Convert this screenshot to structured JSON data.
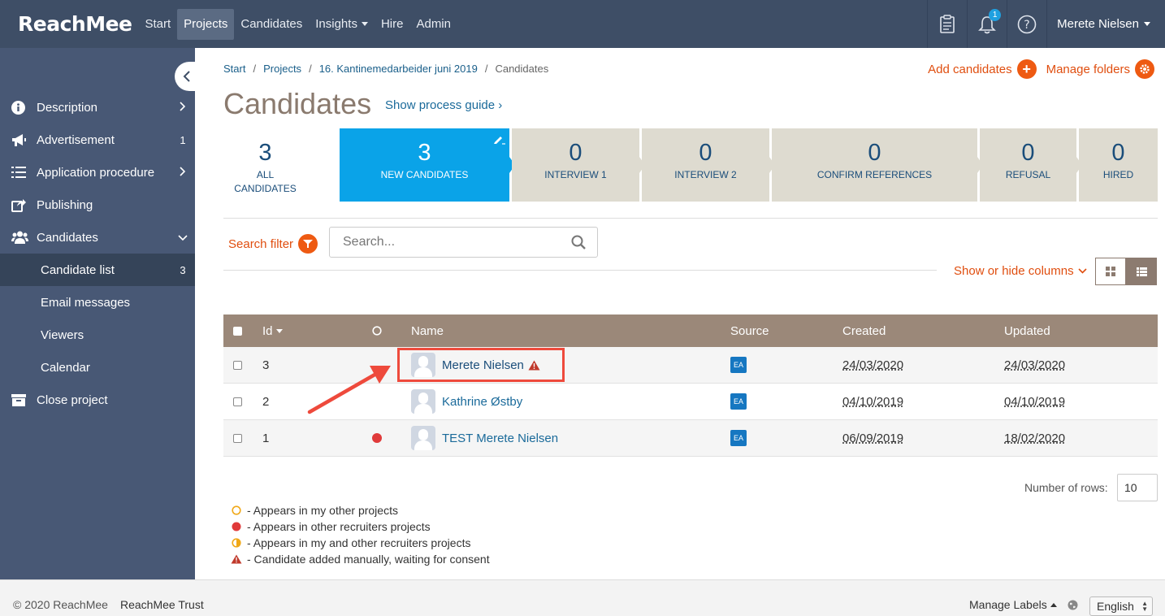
{
  "topnav": {
    "logo": "ReachMee",
    "items": [
      {
        "label": "Start"
      },
      {
        "label": "Projects"
      },
      {
        "label": "Candidates"
      },
      {
        "label": "Insights"
      },
      {
        "label": "Hire"
      },
      {
        "label": "Admin"
      }
    ],
    "notification_count": "1",
    "user": "Merete Nielsen"
  },
  "sidebar": {
    "items": [
      {
        "label": "Description",
        "icon": "info-icon"
      },
      {
        "label": "Advertisement",
        "icon": "megaphone-icon",
        "count": "1"
      },
      {
        "label": "Application procedure",
        "icon": "list-icon"
      },
      {
        "label": "Publishing",
        "icon": "share-icon"
      },
      {
        "label": "Candidates",
        "icon": "users-icon"
      },
      {
        "label": "Candidate list",
        "count": "3"
      },
      {
        "label": "Email messages"
      },
      {
        "label": "Viewers"
      },
      {
        "label": "Calendar"
      },
      {
        "label": "Close project",
        "icon": "archive-icon"
      }
    ]
  },
  "breadcrumb": {
    "start": "Start",
    "projects": "Projects",
    "project": "16. Kantinemedarbeider juni 2019",
    "current": "Candidates",
    "separator": "/"
  },
  "actions": {
    "add": "Add candidates",
    "manage": "Manage folders"
  },
  "page": {
    "title": "Candidates",
    "guide": "Show process guide ›"
  },
  "pipeline": [
    {
      "count": "3",
      "label": "All candidates"
    },
    {
      "count": "3",
      "label": "New candidates"
    },
    {
      "count": "0",
      "label": "Interview 1"
    },
    {
      "count": "0",
      "label": "Interview 2"
    },
    {
      "count": "0",
      "label": "Confirm references"
    },
    {
      "count": "0",
      "label": "Refusal"
    },
    {
      "count": "0",
      "label": "Hired"
    }
  ],
  "filter": {
    "label": "Search filter",
    "placeholder": "Search...",
    "columns_toggle": "Show or hide columns"
  },
  "table": {
    "headers": {
      "id": "Id",
      "name": "Name",
      "source": "Source",
      "created": "Created",
      "updated": "Updated"
    },
    "rows": [
      {
        "id": "3",
        "name": "Merete Nielsen",
        "source": "EA",
        "created": "24/03/2020",
        "updated": "24/03/2020"
      },
      {
        "id": "2",
        "name": "Kathrine Østby",
        "source": "EA",
        "created": "04/10/2019",
        "updated": "04/10/2019"
      },
      {
        "id": "1",
        "name": "TEST Merete Nielsen",
        "source": "EA",
        "created": "06/09/2019",
        "updated": "18/02/2020"
      }
    ]
  },
  "pagination": {
    "rows_label": "Number of rows:",
    "rows_value": "10"
  },
  "legend": [
    {
      "text": "- Appears in my other projects"
    },
    {
      "text": "- Appears in other recruiters projects"
    },
    {
      "text": "- Appears in my and other recruiters projects"
    },
    {
      "text": "- Candidate added manually, waiting for consent"
    }
  ],
  "footer": {
    "copyright": "© 2020 ReachMee",
    "trust": "ReachMee Trust",
    "labels": "Manage Labels",
    "language": "English"
  },
  "colors": {
    "nav": "#3e4e66",
    "sidebar": "#485875",
    "accent": "#ee5a12",
    "active_stage": "#0aa3e8",
    "table_header": "#9b8879"
  }
}
